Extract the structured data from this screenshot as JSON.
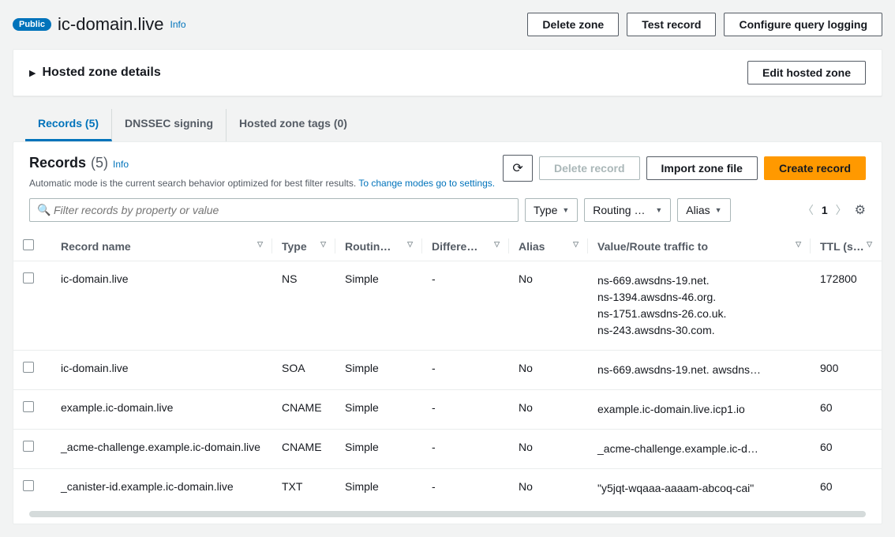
{
  "header": {
    "badge": "Public",
    "zone_name": "ic-domain.live",
    "info": "Info",
    "buttons": {
      "delete_zone": "Delete zone",
      "test_record": "Test record",
      "configure_logging": "Configure query logging"
    }
  },
  "details_panel": {
    "title": "Hosted zone details",
    "edit": "Edit hosted zone"
  },
  "tabs": {
    "records": "Records (5)",
    "dnssec": "DNSSEC signing",
    "tags": "Hosted zone tags (0)"
  },
  "records_section": {
    "title": "Records",
    "count": "(5)",
    "info": "Info",
    "desc": "Automatic mode is the current search behavior optimized for best filter results.",
    "desc_link": "To change modes go to settings.",
    "actions": {
      "delete": "Delete record",
      "import": "Import zone file",
      "create": "Create record"
    },
    "filters": {
      "search_placeholder": "Filter records by property or value",
      "type": "Type",
      "routing": "Routing pol…",
      "alias": "Alias"
    },
    "page": "1",
    "columns": {
      "name": "Record name",
      "type": "Type",
      "routing": "Routin…",
      "differ": "Differe…",
      "alias": "Alias",
      "value": "Value/Route traffic to",
      "ttl": "TTL (s…"
    },
    "rows": [
      {
        "name": "ic-domain.live",
        "type": "NS",
        "routing": "Simple",
        "differ": "-",
        "alias": "No",
        "value": "ns-669.awsdns-19.net.\nns-1394.awsdns-46.org.\nns-1751.awsdns-26.co.uk.\nns-243.awsdns-30.com.",
        "ttl": "172800"
      },
      {
        "name": "ic-domain.live",
        "type": "SOA",
        "routing": "Simple",
        "differ": "-",
        "alias": "No",
        "value": "ns-669.awsdns-19.net. awsdns…",
        "ttl": "900"
      },
      {
        "name": "example.ic-domain.live",
        "type": "CNAME",
        "routing": "Simple",
        "differ": "-",
        "alias": "No",
        "value": "example.ic-domain.live.icp1.io",
        "ttl": "60"
      },
      {
        "name": "_acme-challenge.example.ic-domain.live",
        "type": "CNAME",
        "routing": "Simple",
        "differ": "-",
        "alias": "No",
        "value": "_acme-challenge.example.ic-d…",
        "ttl": "60"
      },
      {
        "name": "_canister-id.example.ic-domain.live",
        "type": "TXT",
        "routing": "Simple",
        "differ": "-",
        "alias": "No",
        "value": "\"y5jqt-wqaaa-aaaam-abcoq-cai\"",
        "ttl": "60"
      }
    ]
  }
}
